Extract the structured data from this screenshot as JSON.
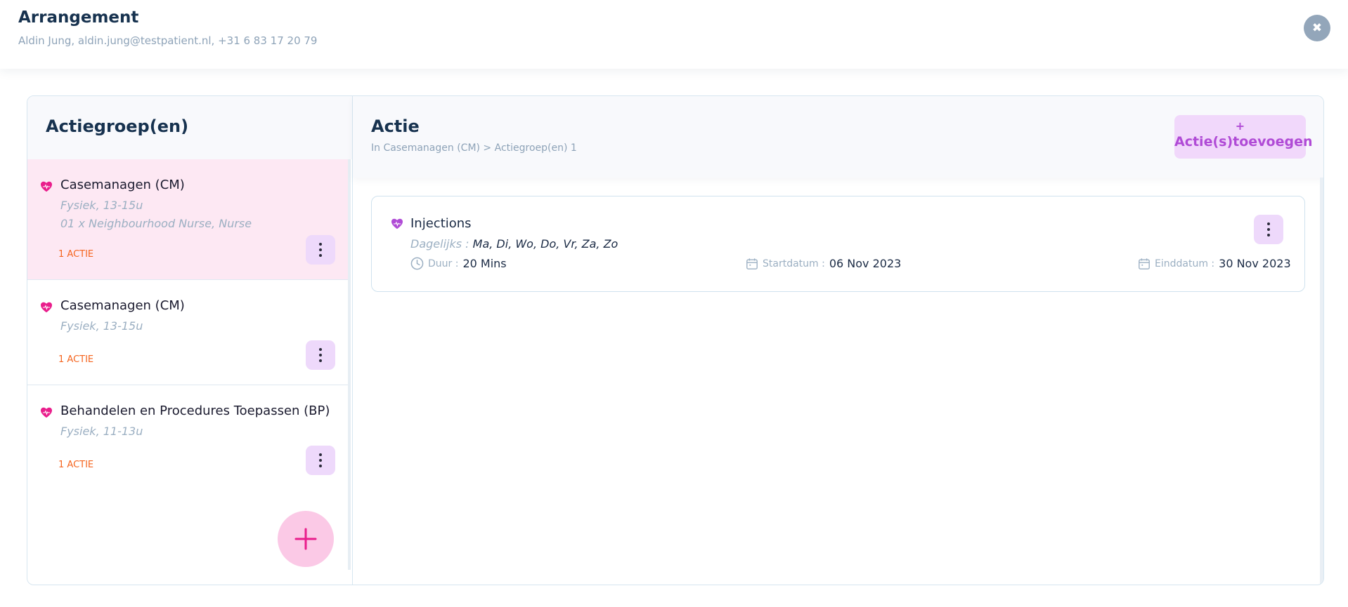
{
  "header": {
    "title": "Arrangement",
    "subtitle": "Aldin Jung, aldin.jung@testpatient.nl, +31 6 83 17 20 79",
    "close_icon": "close-icon"
  },
  "left": {
    "title": "Actiegroep(en)",
    "groups": [
      {
        "title": "Casemanagen (CM)",
        "line1": "Fysiek, 13-15u",
        "line2": "01 x Neighbourhood Nurse, Nurse",
        "count": "1 ACTIE",
        "icon": "heart-pulse-icon",
        "active": true
      },
      {
        "title": "Casemanagen (CM)",
        "line1": "Fysiek, 13-15u",
        "count": "1 ACTIE",
        "icon": "heart-pulse-icon",
        "active": false
      },
      {
        "title": "Behandelen en Procedures Toepassen (BP)",
        "line1": "Fysiek, 11-13u",
        "count": "1 ACTIE",
        "icon": "heart-pulse-icon",
        "active": false
      }
    ],
    "fab_icon": "plus-icon"
  },
  "right": {
    "title": "Actie",
    "breadcrumb": "In Casemanagen (CM) > Actiegroep(en) 1",
    "add_button": {
      "plus": "+",
      "label": "Actie(s)toevoegen"
    },
    "actions": [
      {
        "name": "Injections",
        "freq_label": "Dagelijks :",
        "freq_value": "Ma, Di, Wo, Do, Vr, Za, Zo",
        "duration_label": "Duur :",
        "duration_value": "20 Mins",
        "start_label": "Startdatum :",
        "start_value": "06 Nov 2023",
        "end_label": "Einddatum :",
        "end_value": "30 Nov 2023"
      }
    ]
  },
  "colors": {
    "accent_pink": "#e91e8c",
    "accent_purple": "#b04bd6",
    "count_orange": "#f5651f",
    "active_bg": "#fde8f3"
  }
}
